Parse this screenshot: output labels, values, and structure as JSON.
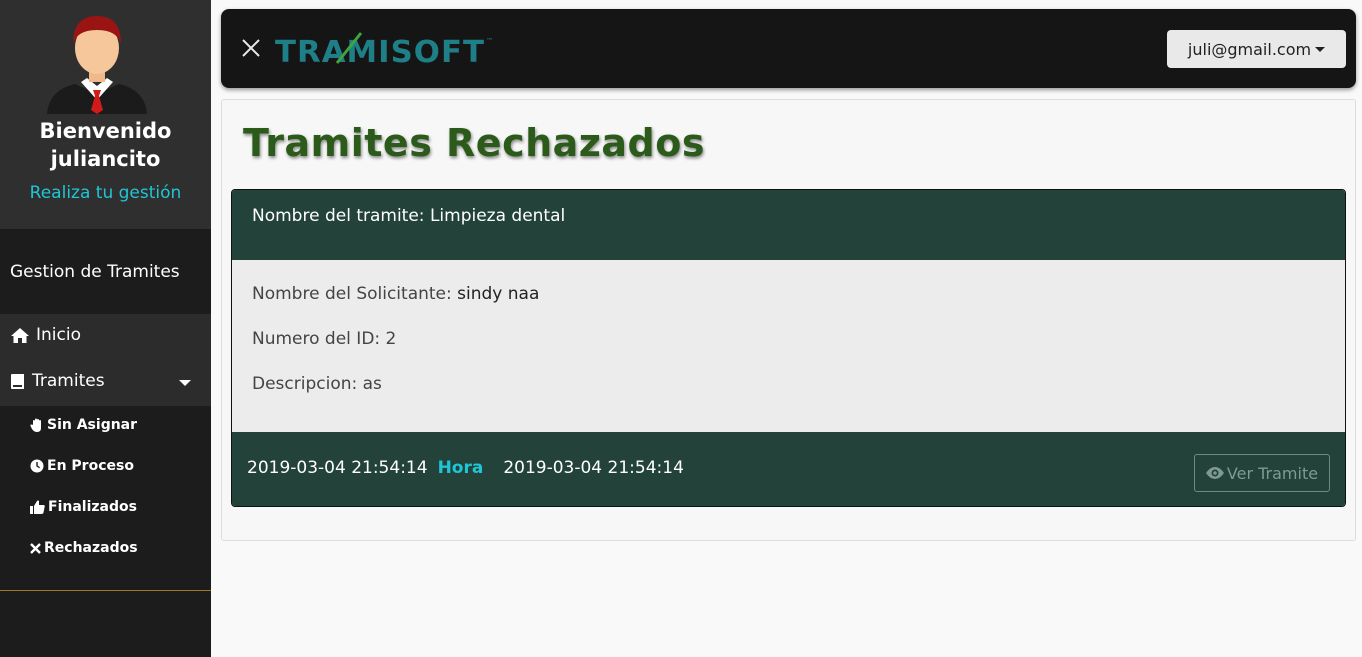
{
  "sidebar": {
    "welcome_title": "Bienvenido",
    "username": "juliancito",
    "welcome_sub": "Realiza tu gestión",
    "section_title": "Gestion de Tramites",
    "nav": {
      "inicio": "Inicio",
      "tramites": "Tramites"
    },
    "sub_items": {
      "sin_asignar": "Sin Asignar",
      "en_proceso": "En Proceso",
      "finalizados": "Finalizados",
      "rechazados": "Rechazados"
    }
  },
  "topbar": {
    "logo_text": "TRAMISOFT",
    "user_email": "juli@gmail.com"
  },
  "main": {
    "page_title": "Tramites Rechazados",
    "card": {
      "tramite_label": "Nombre del tramite: ",
      "tramite_value": "Limpieza dental",
      "solicitante_label": "Nombre del Solicitante: ",
      "solicitante_value": "sindy naa",
      "id_label": "Numero del ID: ",
      "id_value": "2",
      "descripcion_label": "Descripcion: ",
      "descripcion_value": "as",
      "fecha_inicio": "2019-03-04 21:54:14",
      "hora_label": "Hora",
      "fecha_fin": "2019-03-04 21:54:14",
      "ver_button": "Ver Tramite"
    }
  },
  "colors": {
    "accent_cyan": "#1fc6d6",
    "card_header": "#22423a",
    "title_green": "#2b5a1a"
  }
}
